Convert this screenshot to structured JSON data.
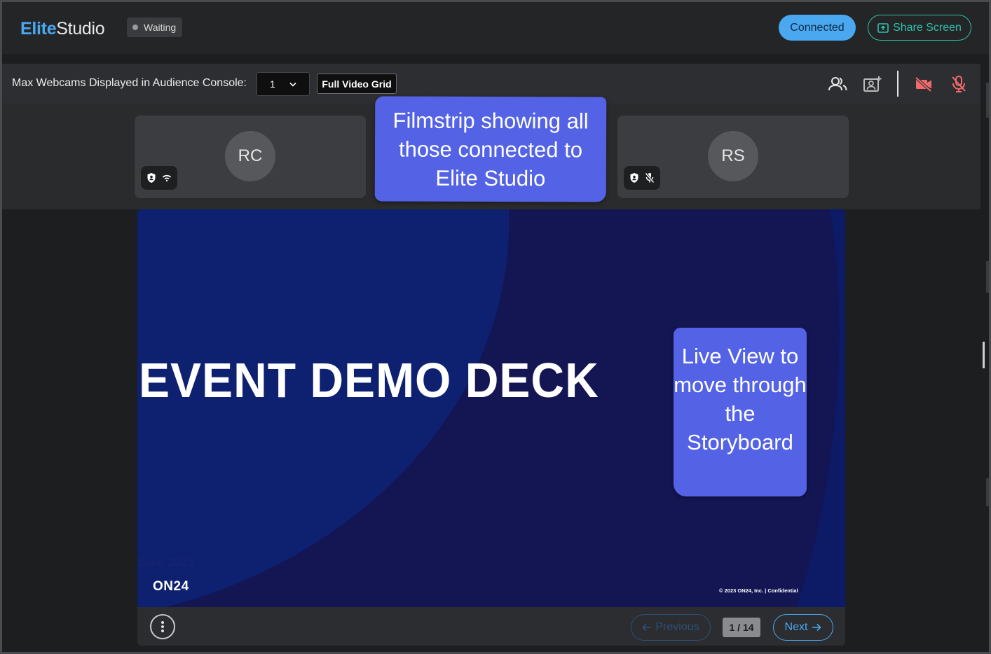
{
  "header": {
    "logo_primary": "Elite",
    "logo_secondary": "Studio",
    "status": "Waiting",
    "connected_label": "Connected",
    "share_label": "Share Screen"
  },
  "controls": {
    "webcam_label": "Max Webcams Displayed in Audience Console:",
    "webcam_count": "1",
    "full_grid_label": "Full Video Grid",
    "icons": [
      "people-icon",
      "add-presenter-icon",
      "camera-off-icon",
      "mic-off-icon"
    ],
    "danger_color": "#f06a6a"
  },
  "filmstrip": {
    "participants": [
      {
        "initials": "RC",
        "badges": [
          "shield-icon",
          "signal-icon"
        ]
      },
      {
        "initials": "RS",
        "badges": [
          "shield-icon",
          "mic-off-icon"
        ]
      }
    ]
  },
  "slide": {
    "title": "EVENT DEMO DECK",
    "date": "Date 2023",
    "logo": "ON24",
    "copyright": "© 2023 ON24, Inc.  |  Confidential"
  },
  "nav": {
    "previous_label": "Previous",
    "page_indicator": "1 / 14",
    "next_label": "Next"
  },
  "callouts": {
    "filmstrip_note": "Filmstrip showing all those connected to Elite Studio",
    "liveview_note": "Live View to move through the Storyboard"
  },
  "colors": {
    "accent": "#4aa8f0",
    "share": "#2fc1a9",
    "callout": "#5463e6",
    "slide_bg": "#0e1357"
  }
}
